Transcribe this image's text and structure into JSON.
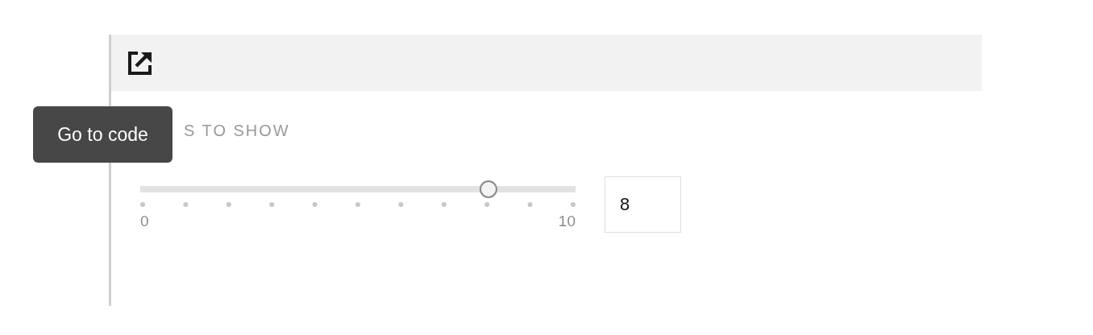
{
  "label": "S TO SHOW",
  "slider": {
    "level": 0.8,
    "min_label": "0",
    "max_label": "10"
  },
  "value_field": {
    "value": "8"
  },
  "tooltip": {
    "text": "Go to code"
  }
}
